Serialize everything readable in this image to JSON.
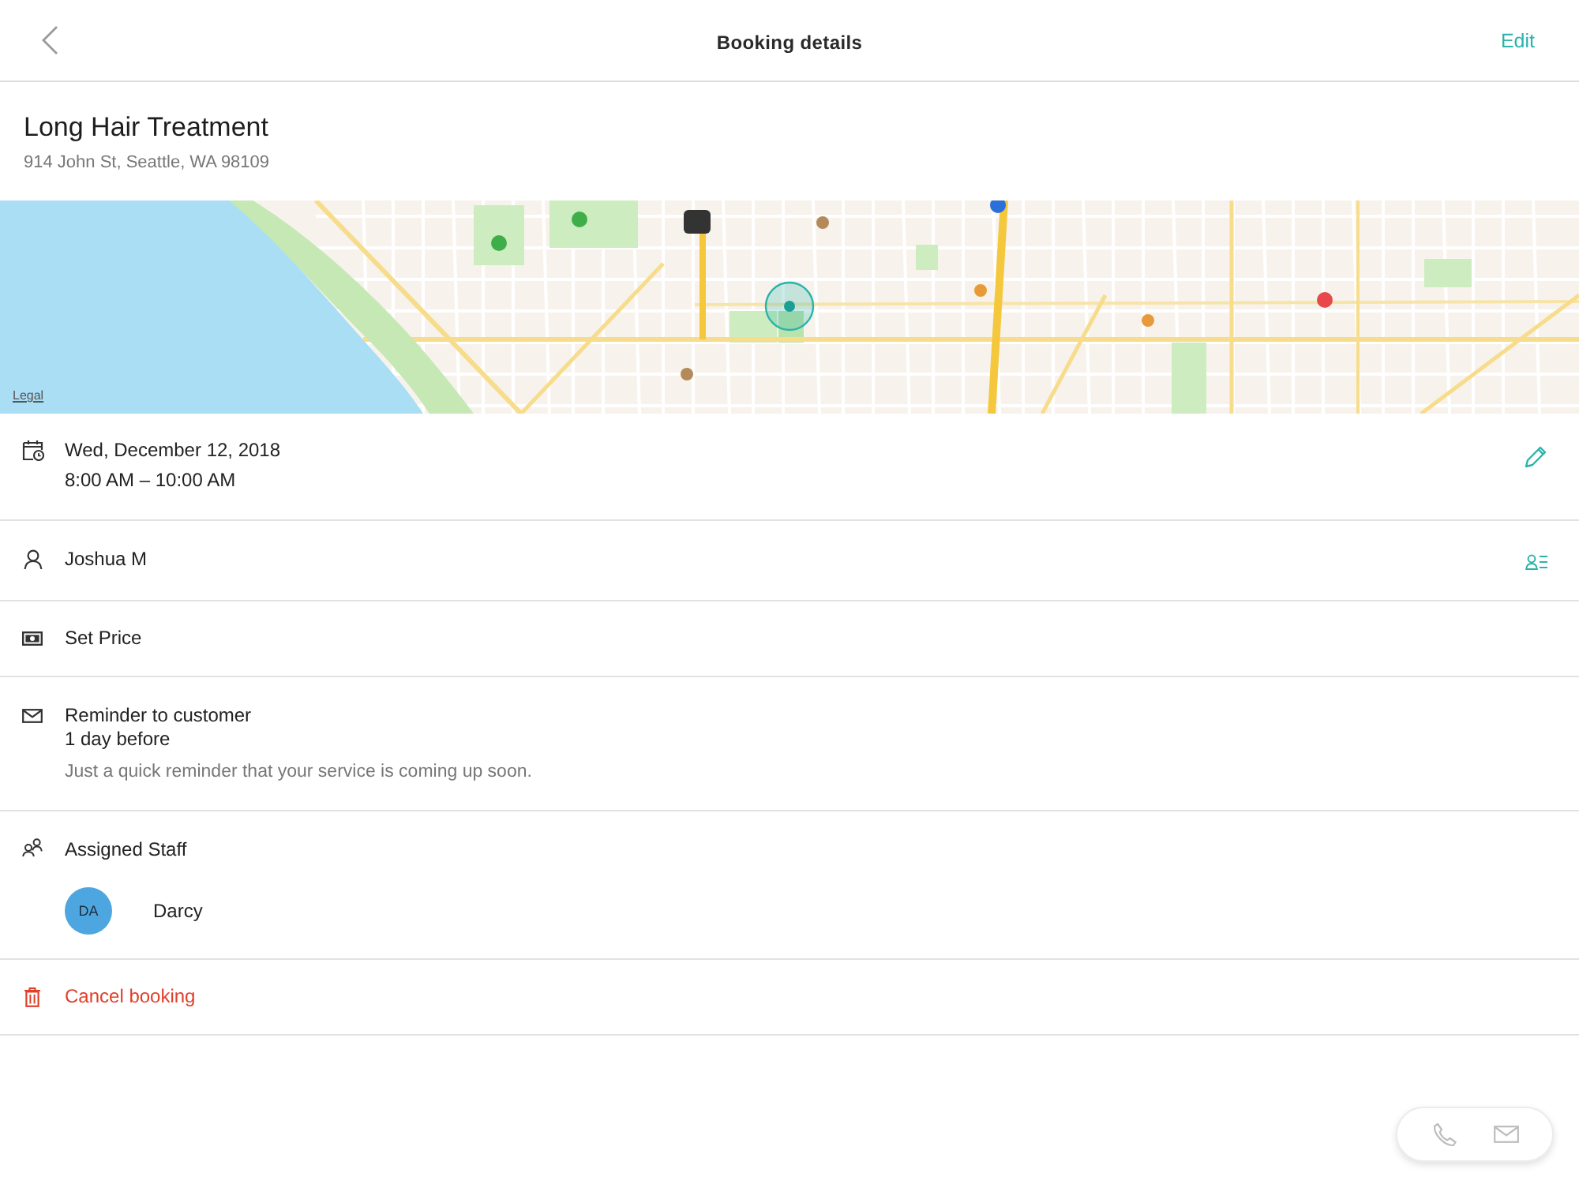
{
  "nav_bar": {
    "title": "Booking details",
    "action": "Edit"
  },
  "booking": {
    "title": "Long Hair Treatment",
    "address": "914 John St, Seattle, WA 98109"
  },
  "map": {
    "legal_link": "Legal"
  },
  "sections": [
    {
      "kind": "schedule",
      "date": "Wed, December 12, 2018",
      "time": "8:00 AM – 10:00 AM"
    },
    {
      "kind": "customer",
      "name": "Joshua M"
    },
    {
      "kind": "price",
      "label": "Set Price"
    },
    {
      "kind": "reminder",
      "title": "Reminder to customer",
      "timing": "1 day before",
      "message": "Just a quick reminder that your service is coming up soon."
    },
    {
      "kind": "staff",
      "title": "Assigned Staff",
      "members": [
        {
          "initials": "DA",
          "name": "Darcy",
          "color": "#4ea6e0"
        }
      ]
    },
    {
      "kind": "cancel",
      "label": "Cancel booking"
    }
  ]
}
